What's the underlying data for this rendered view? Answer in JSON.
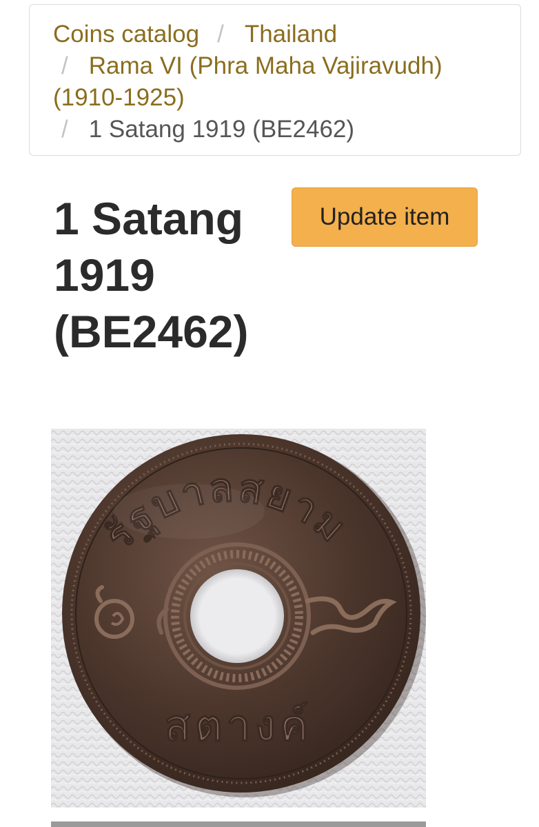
{
  "breadcrumb": {
    "items": [
      {
        "label": "Coins catalog"
      },
      {
        "label": "Thailand"
      },
      {
        "label": "Rama VI (Phra Maha Vajiravudh) (1910-1925)"
      },
      {
        "label": "1 Satang 1919 (BE2462)"
      }
    ],
    "separator": "/"
  },
  "title": "1 Satang 1919 (BE2462)",
  "update_button": {
    "label": "Update item"
  },
  "coin_image": {
    "top_inscription": "รัฐบาลสยาม",
    "bottom_inscription": "สตางค์",
    "denomination_numeral": "๑"
  },
  "colors": {
    "link": "#8a6d1e",
    "button": "#f3b04c",
    "title": "#2b2b2b"
  },
  "icons": {
    "separator": "slash"
  }
}
